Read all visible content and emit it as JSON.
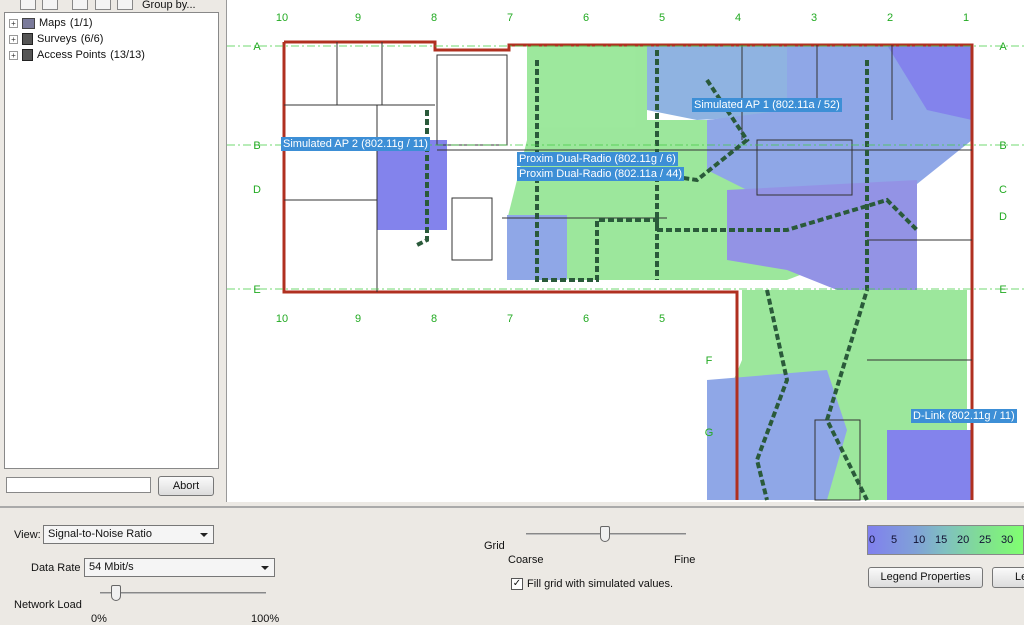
{
  "toolbar": {
    "group_by": "Group by..."
  },
  "tree": {
    "items": [
      {
        "label": "Maps",
        "count": "(1/1)",
        "icon": "folder-icon"
      },
      {
        "label": "Surveys",
        "count": "(6/6)",
        "icon": "survey-icon"
      },
      {
        "label": "Access Points",
        "count": "(13/13)",
        "icon": "access-point-icon"
      }
    ]
  },
  "progress": {
    "value": 0
  },
  "abort_label": "Abort",
  "map": {
    "columns": [
      "10",
      "9",
      "8",
      "7",
      "6",
      "5",
      "4",
      "3",
      "2",
      "1"
    ],
    "rows_left": [
      "A",
      "B",
      "D",
      "E"
    ],
    "rows_right": [
      "A",
      "B",
      "C",
      "D",
      "E"
    ],
    "rows_lower": [
      "F",
      "G"
    ],
    "ap_labels": [
      "Simulated AP 1 (802.11a / 52)",
      "Simulated AP 2 (802.11g / 11)",
      "Proxim Dual-Radio (802.11g / 6)",
      "Proxim Dual-Radio (802.11a / 44)",
      "D-Link (802.11g / 11)"
    ]
  },
  "controls": {
    "view_label": "View:",
    "view_value": "Signal-to-Noise Ratio",
    "data_rate_label": "Data Rate",
    "data_rate_value": "54 Mbit/s",
    "network_load_label": "Network Load",
    "network_load_min": "0%",
    "network_load_max": "100%",
    "network_load_value_percent": 10,
    "grid_label": "Grid",
    "grid_coarse": "Coarse",
    "grid_fine": "Fine",
    "grid_value_fraction": 0.5,
    "fill_grid_label": "Fill grid with simulated values.",
    "fill_grid_checked": true
  },
  "legend": {
    "ticks": [
      "0",
      "5",
      "10",
      "15",
      "20",
      "25",
      "30"
    ],
    "colors": [
      "#8080ee",
      "#80a0d8",
      "#80c0c0",
      "#80e090",
      "#80ff70"
    ]
  },
  "legend_properties_label": "Legend Properties",
  "legend_second_label": "Le"
}
